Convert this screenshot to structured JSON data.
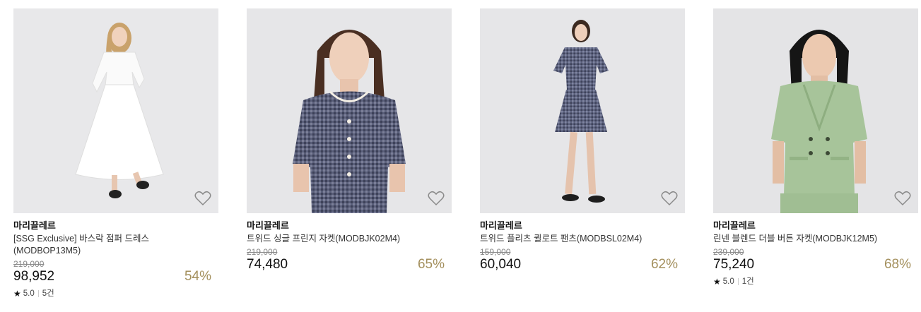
{
  "products": [
    {
      "brand": "마리끌레르",
      "name": "[SSG Exclusive] 바스락 점퍼 드레스 (MODBOP13M5)",
      "original_price": "219,000",
      "sale_price": "98,952",
      "discount": "54%",
      "rating": "5.0",
      "review_count": "5건",
      "image_icon": "white-dress-photo"
    },
    {
      "brand": "마리끌레르",
      "name": "트위드 싱글 프린지 자켓(MODBJK02M4)",
      "original_price": "219,000",
      "sale_price": "74,480",
      "discount": "65%",
      "image_icon": "tweed-jacket-photo"
    },
    {
      "brand": "마리끌레르",
      "name": "트위드 플리츠 퀼로트 팬츠(MODBSL02M4)",
      "original_price": "159,000",
      "sale_price": "60,040",
      "discount": "62%",
      "image_icon": "tweed-culotte-photo"
    },
    {
      "brand": "마리끌레르",
      "name": "린넨 블렌드 더블 버튼 자켓(MODBJK12M5)",
      "original_price": "239,000",
      "sale_price": "75,240",
      "discount": "68%",
      "rating": "5.0",
      "review_count": "1건",
      "image_icon": "green-linen-jacket-photo"
    }
  ],
  "colors": {
    "discount": "#a38f5c",
    "image_background": "#e6e6e8",
    "tweed": "#5a5f7a",
    "linen_green": "#a7c49a"
  },
  "icons": {
    "wishlist": "heart-outline-icon",
    "rating": "star-icon"
  }
}
